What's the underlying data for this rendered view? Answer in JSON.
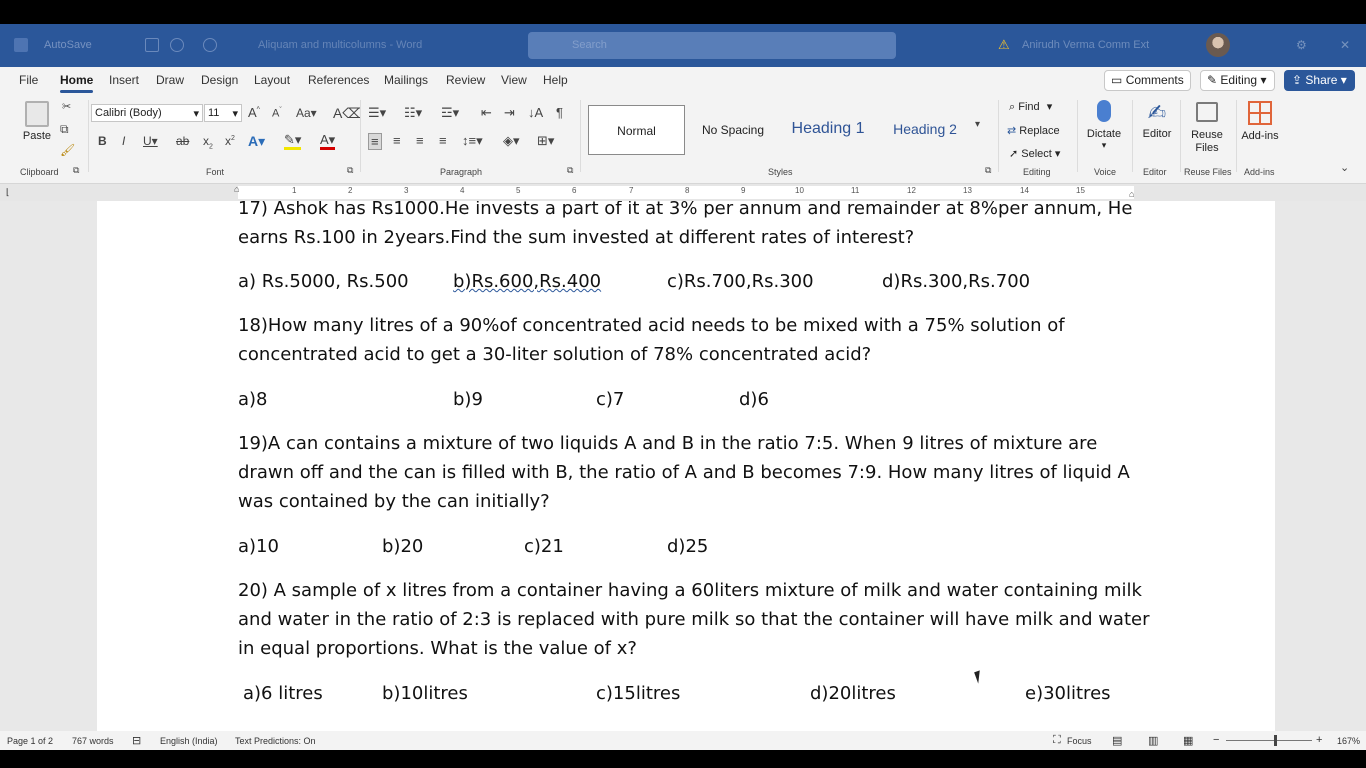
{
  "window": {
    "title_blurred": "Aliquam and multicolumns - Word",
    "autosave": "AutoSave",
    "search_placeholder": "Search",
    "user_name": "Anirudh Verma Comm Ext",
    "share_label": "Share",
    "comments_label": "Comments",
    "editing_label": "Editing"
  },
  "ribbon": {
    "tabs": [
      "File",
      "Home",
      "Insert",
      "Draw",
      "Design",
      "Layout",
      "References",
      "Mailings",
      "Review",
      "View",
      "Help"
    ],
    "active_tab": "Home",
    "clipboard": {
      "paste_label": "Paste",
      "group_label": "Clipboard"
    },
    "font": {
      "family": "Calibri (Body)",
      "size": "11",
      "group_label": "Font"
    },
    "paragraph": {
      "group_label": "Paragraph"
    },
    "styles": {
      "items": [
        "Normal",
        "No Spacing",
        "Heading 1",
        "Heading 2"
      ],
      "group_label": "Styles"
    },
    "editing": {
      "find": "Find",
      "replace": "Replace",
      "select": "Select",
      "group_label": "Editing"
    },
    "voice": {
      "dictate": "Dictate",
      "group_label": "Voice"
    },
    "editor": {
      "label": "Editor",
      "group_label": "Editor"
    },
    "reuse": {
      "label1": "Reuse",
      "label2": "Files",
      "group_label": "Reuse Files"
    },
    "addins": {
      "label": "Add-ins",
      "group_label": "Add-ins"
    },
    "accent_color": "#2b579a"
  },
  "ruler": {
    "numbers": [
      "1",
      "2",
      "3",
      "4",
      "5",
      "6",
      "7",
      "8",
      "9",
      "10",
      "11",
      "12",
      "13",
      "14",
      "15"
    ]
  },
  "document": {
    "q17": {
      "line1": "17) Ashok has Rs1000.He invests a part of it at 3% per annum and remainder at 8%per annum, He",
      "line2": "earns Rs.100 in 2years.Find the sum invested at different rates of interest?",
      "options": [
        "a) Rs.5000, Rs.500",
        "b)Rs.600,Rs.400",
        "c)Rs.700,Rs.300",
        "d)Rs.300,Rs.700"
      ]
    },
    "q18": {
      "line1": "18)How many litres of a 90%of concentrated acid needs to be mixed with a 75% solution of",
      "line2": "concentrated acid to get a 30-liter solution of 78% concentrated acid?",
      "options": [
        "a)8",
        "b)9",
        "c)7",
        "d)6"
      ]
    },
    "q19": {
      "line1": "19)A can contains a mixture of two liquids A and B in the ratio 7:5. When 9 litres of mixture are",
      "line2": "drawn off and the can is filled with B, the ratio of A and B becomes 7:9. How many litres of liquid A",
      "line3": "was contained by the can initially?",
      "options": [
        "a)10",
        "b)20",
        "c)21",
        "d)25"
      ]
    },
    "q20": {
      "line1": "20) A sample of x litres from a container having a 60liters mixture of milk and water containing milk",
      "line2": "and water in the ratio of 2:3 is replaced with pure milk so that the container will have milk and water",
      "line3": "in equal proportions. What is the value of x?",
      "options": [
        "a)6 litres",
        "b)10litres",
        "c)15litres",
        "d)20litres",
        "e)30litres"
      ]
    }
  },
  "statusbar": {
    "page": "Page 1 of 2",
    "words": "767 words",
    "language": "English (India)",
    "predictions": "Text Predictions: On",
    "focus": "Focus",
    "zoom": "167%"
  }
}
